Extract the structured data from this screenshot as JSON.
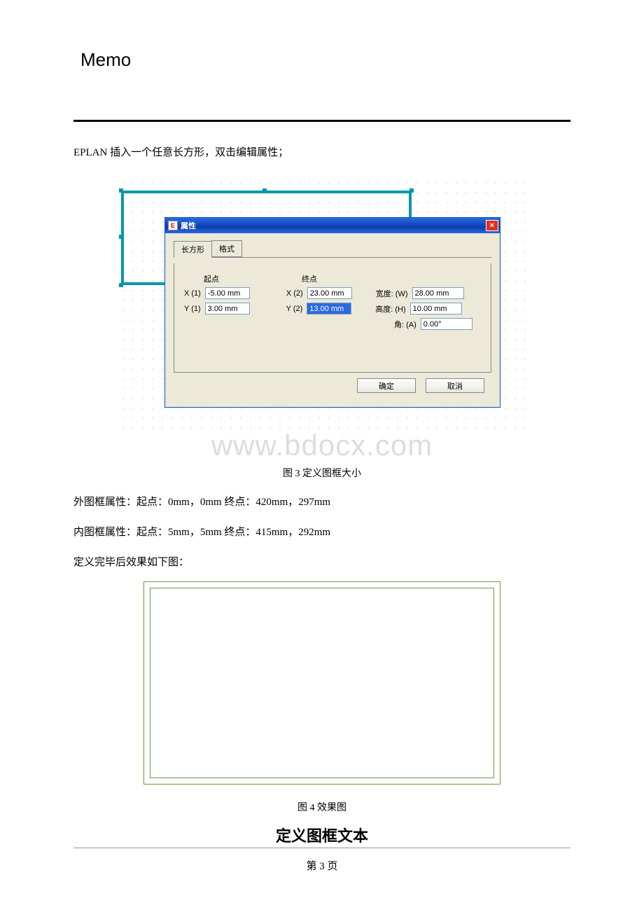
{
  "header": {
    "memo": "Memo"
  },
  "intro": "EPLAN 插入一个任意长方形，双击编辑属性；",
  "dialog": {
    "title": "属性",
    "close_glyph": "×",
    "tab_rect": "长方形",
    "tab_format": "格式",
    "col_start": "起点",
    "col_end": "终点",
    "x1_label": "X  (1)",
    "x1_value": "-5.00 mm",
    "x2_label": "X  (2)",
    "x2_value": "23.00 mm",
    "y1_label": "Y  (1)",
    "y1_value": "3.00 mm",
    "y2_label": "Y  (2)",
    "y2_value": "13.00 mm",
    "width_label": "宽度:  (W)",
    "width_value": "28.00 mm",
    "height_label": "高度:  (H)",
    "height_value": "10.00 mm",
    "angle_label": "角:  (A)",
    "angle_value": "0.00°",
    "ok": "确定",
    "cancel": "取消"
  },
  "watermark": "www.bdocx.com",
  "fig3_caption": "图 3 定义图框大小",
  "para1": "外图框属性：起点：0mm，0mm  终点：420mm，297mm",
  "para2": "内图框属性：起点：5mm，5mm  终点：415mm，292mm",
  "para3": "定义完毕后效果如下图：",
  "fig4_caption": "图 4 效果图",
  "section_title": "定义图框文本",
  "page_number": "第 3 页"
}
